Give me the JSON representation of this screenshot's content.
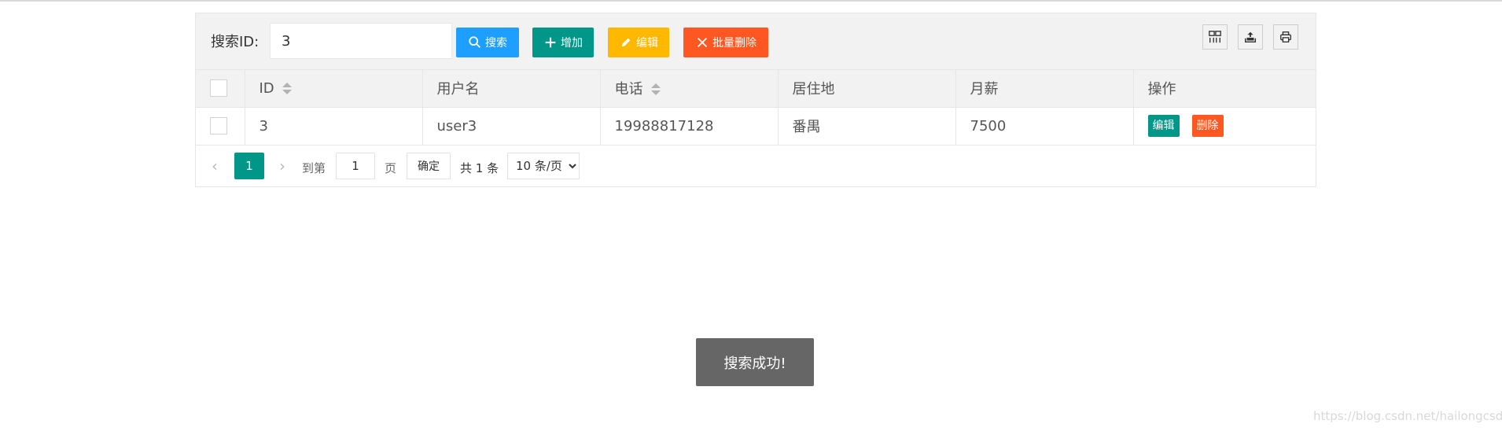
{
  "toolbar": {
    "search_label": "搜索ID:",
    "search_value": "3",
    "search_button": "搜索",
    "add_button": "增加",
    "edit_button": "编辑",
    "batch_delete_button": "批量删除",
    "icons": [
      "columns-icon",
      "export-icon",
      "print-icon"
    ]
  },
  "table": {
    "columns": [
      "ID",
      "用户名",
      "电话",
      "居住地",
      "月薪",
      "操作"
    ],
    "rows": [
      {
        "id": "3",
        "username": "user3",
        "phone": "19988817128",
        "residence": "番禺",
        "salary": "7500",
        "edit_label": "编辑",
        "delete_label": "删除"
      }
    ]
  },
  "pager": {
    "current_page": "1",
    "goto_label": "到第",
    "goto_value": "1",
    "page_label": "页",
    "confirm_label": "确定",
    "total_label": "共 1 条",
    "page_size_selected": "10 条/页"
  },
  "toast": {
    "message": "搜索成功!"
  },
  "watermark": "https://blog.csdn.net/hailongcsdn",
  "colors": {
    "blue": "#1e9fff",
    "green": "#009688",
    "yellow": "#ffb800",
    "red": "#ff5722",
    "toast": "#666666"
  }
}
